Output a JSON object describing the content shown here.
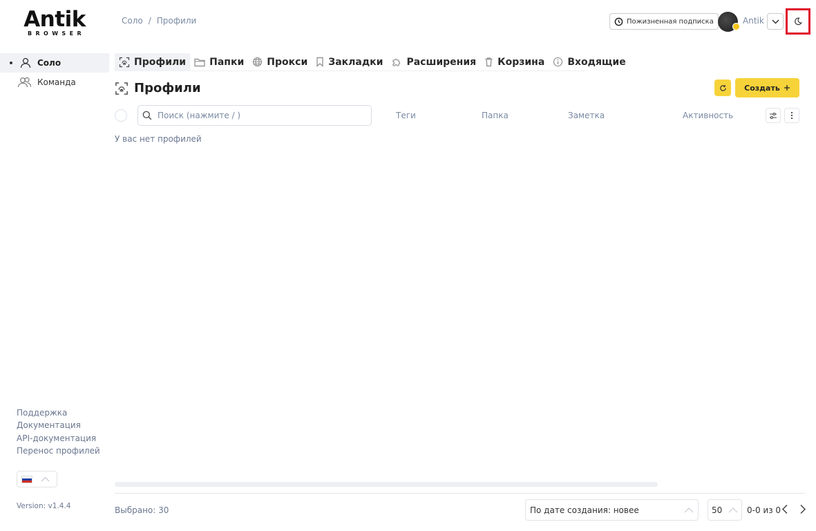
{
  "logo": {
    "main": "Antik",
    "sub": "BROWSER"
  },
  "breadcrumb": {
    "items": [
      "Соло",
      "/",
      "Профили"
    ]
  },
  "header": {
    "subscription_label": "Пожизненная подписка",
    "username": "Antik",
    "icons": {
      "subscription": "clock-icon",
      "dropdown": "chevron-down-icon",
      "theme": "moon-icon"
    }
  },
  "sidebar": {
    "items": [
      {
        "label": "Соло",
        "icon": "user-icon",
        "active": true
      },
      {
        "label": "Команда",
        "icon": "users-icon",
        "active": false
      }
    ],
    "links": [
      "Поддержка",
      "Документация",
      "API-документация",
      "Перенос профилей"
    ],
    "language_flag": "ru-flag-icon",
    "version": "Version: v1.4.4"
  },
  "tabs": [
    {
      "label": "Профили",
      "icon": "fingerprint-icon",
      "active": true
    },
    {
      "label": "Папки",
      "icon": "folder-icon",
      "active": false
    },
    {
      "label": "Прокси",
      "icon": "globe-icon",
      "active": false
    },
    {
      "label": "Закладки",
      "icon": "bookmark-icon",
      "active": false
    },
    {
      "label": "Расширения",
      "icon": "puzzle-icon",
      "active": false
    },
    {
      "label": "Корзина",
      "icon": "trash-icon",
      "active": false
    },
    {
      "label": "Входящие",
      "icon": "info-icon",
      "active": false
    }
  ],
  "main": {
    "title": "Профили",
    "create_label": "Создать",
    "search_placeholder": "Поиск (нажмите / )",
    "columns": [
      "Теги",
      "Папка",
      "Заметка",
      "Активность"
    ],
    "empty_message": "У вас нет профилей"
  },
  "footer": {
    "selected": "Выбрано: 30",
    "sort_value": "По дате создания: новее",
    "per_page": "50",
    "range": "0-0 из 0"
  },
  "colors": {
    "accent": "#f7d33a",
    "highlight": "#e0112b",
    "muted_text": "#7a8aa3"
  }
}
